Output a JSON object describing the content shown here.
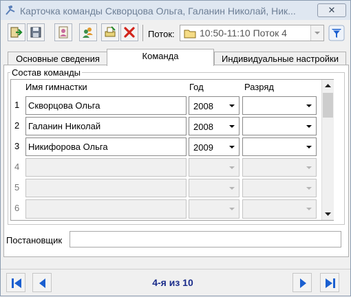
{
  "window": {
    "title": "Карточка команды Скворцова Ольга, Галанин Николай, Ник...",
    "close_label": "✕"
  },
  "toolbar": {
    "buttons": [
      "exit",
      "save",
      "card",
      "users",
      "print",
      "delete"
    ],
    "flow_label": "Поток:",
    "flow_value": "10:50-11:10 Поток 4"
  },
  "tabs": [
    {
      "label": "Основные сведения"
    },
    {
      "label": "Команда",
      "active": true
    },
    {
      "label": "Индивидуальные настройки"
    }
  ],
  "team": {
    "group_label": "Состав команды",
    "columns": {
      "name": "Имя гимнастки",
      "year": "Год",
      "rank": "Разряд"
    },
    "rows": [
      {
        "num": "1",
        "name": "Скворцова Ольга",
        "year": "2008",
        "rank": ""
      },
      {
        "num": "2",
        "name": "Галанин Николай",
        "year": "2008",
        "rank": ""
      },
      {
        "num": "3",
        "name": "Никифорова Ольга",
        "year": "2009",
        "rank": ""
      },
      {
        "num": "4",
        "name": "",
        "year": "",
        "rank": ""
      },
      {
        "num": "5",
        "name": "",
        "year": "",
        "rank": ""
      },
      {
        "num": "6",
        "name": "",
        "year": "",
        "rank": ""
      }
    ]
  },
  "author": {
    "label": "Постановщик",
    "value": ""
  },
  "nav": {
    "counter": "4-я из 10"
  },
  "colors": {
    "accent": "#1a5fd0",
    "counter": "#1a2c8a"
  }
}
